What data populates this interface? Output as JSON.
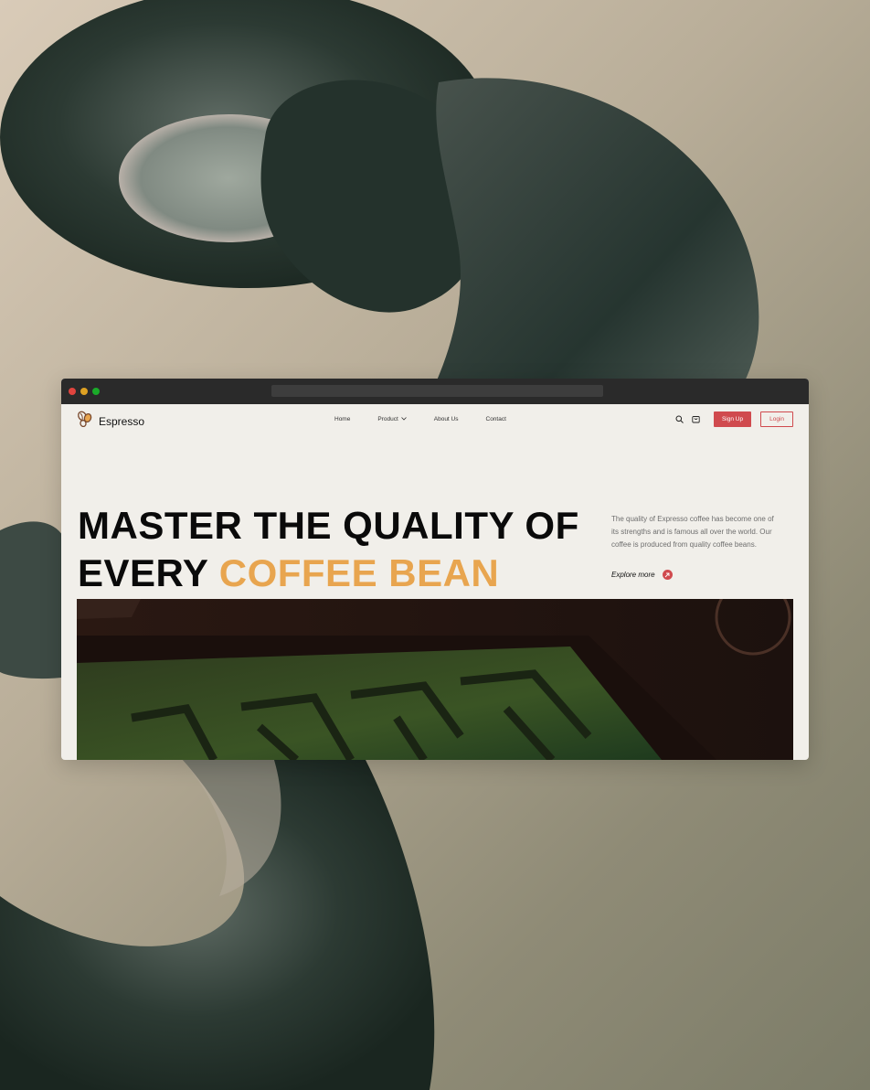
{
  "browser": {
    "brand": {
      "name": "Espresso"
    },
    "nav": {
      "items": [
        {
          "label": "Home"
        },
        {
          "label": "Product",
          "has_dropdown": true
        },
        {
          "label": "About Us"
        },
        {
          "label": "Contact"
        }
      ],
      "search_icon": "search-icon",
      "cart_icon": "cart-icon",
      "signup_label": "Sign Up",
      "login_label": "Login"
    },
    "hero": {
      "headline_line1": "MASTER THE QUALITY OF",
      "headline_line2_prefix": "EVERY",
      "headline_line2_accent": "COFFEE BEAN",
      "description": "The quality of Expresso coffee has become one of its strengths and is famous all over the world. Our coffee is produced from quality coffee beans.",
      "explore_label": "Explore more",
      "explore_icon": "arrow-up-right-icon"
    }
  },
  "colors": {
    "accent": "#e8a54f",
    "primary": "#d04a4e",
    "page_bg": "#f1efea",
    "chrome": "#2a2a2a"
  }
}
